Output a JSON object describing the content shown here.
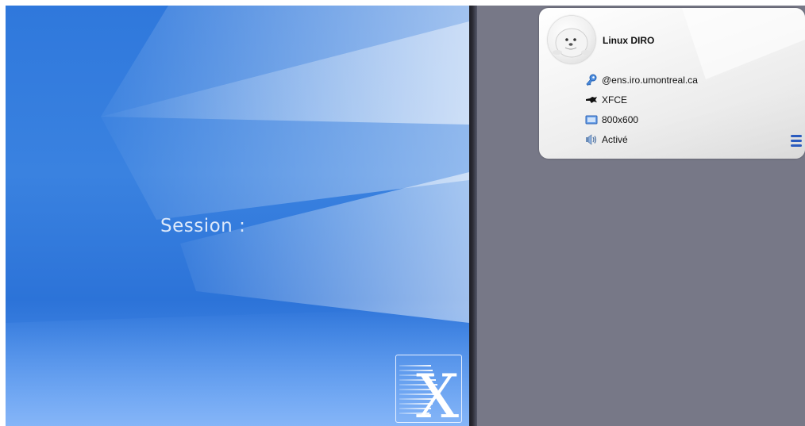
{
  "login": {
    "session_label": "Session :"
  },
  "server_card": {
    "title": "Linux DIRO",
    "rows": [
      {
        "icon": "key-icon",
        "text": "@ens.iro.umontreal.ca"
      },
      {
        "icon": "desktop-environment-icon",
        "text": "XFCE"
      },
      {
        "icon": "display-resolution-icon",
        "text": "800x600"
      },
      {
        "icon": "sound-icon",
        "text": "Activé"
      }
    ],
    "menu_icon": "hamburger-menu-icon"
  },
  "branding": {
    "logo": "x2go-x-logo"
  },
  "colors": {
    "left_panel_blue": "#2f78dc",
    "right_panel_gray": "#777887",
    "card_background": "#f2f2f2",
    "menu_icon_blue": "#2b5bbf"
  }
}
